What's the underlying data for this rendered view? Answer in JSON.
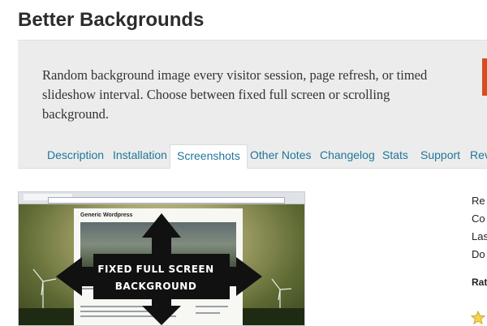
{
  "page": {
    "title": "Better Backgrounds",
    "description": "Random background image every visitor session, page refresh, or timed slideshow interval. Choose between fixed full screen or scrolling background."
  },
  "tabs": [
    {
      "label": "Description",
      "active": false
    },
    {
      "label": "Installation",
      "active": false
    },
    {
      "label": "Screenshots",
      "active": true
    },
    {
      "label": "Other Notes",
      "active": false
    },
    {
      "label": "Changelog",
      "active": false
    },
    {
      "label": "Stats",
      "active": false
    },
    {
      "label": "Support",
      "active": false
    },
    {
      "label": "Rev",
      "active": false
    }
  ],
  "screenshot": {
    "site_title": "Generic Wordpress",
    "overlay_line1": "FIXED FULL SCREEN",
    "overlay_line2": "BACKGROUND"
  },
  "sidebar": {
    "items": [
      "Re",
      "Co",
      "Las",
      "Do"
    ],
    "ratings_label": "Rat"
  },
  "colors": {
    "link": "#21759b",
    "banner_bg": "#ececec",
    "accent": "#d54e21"
  }
}
